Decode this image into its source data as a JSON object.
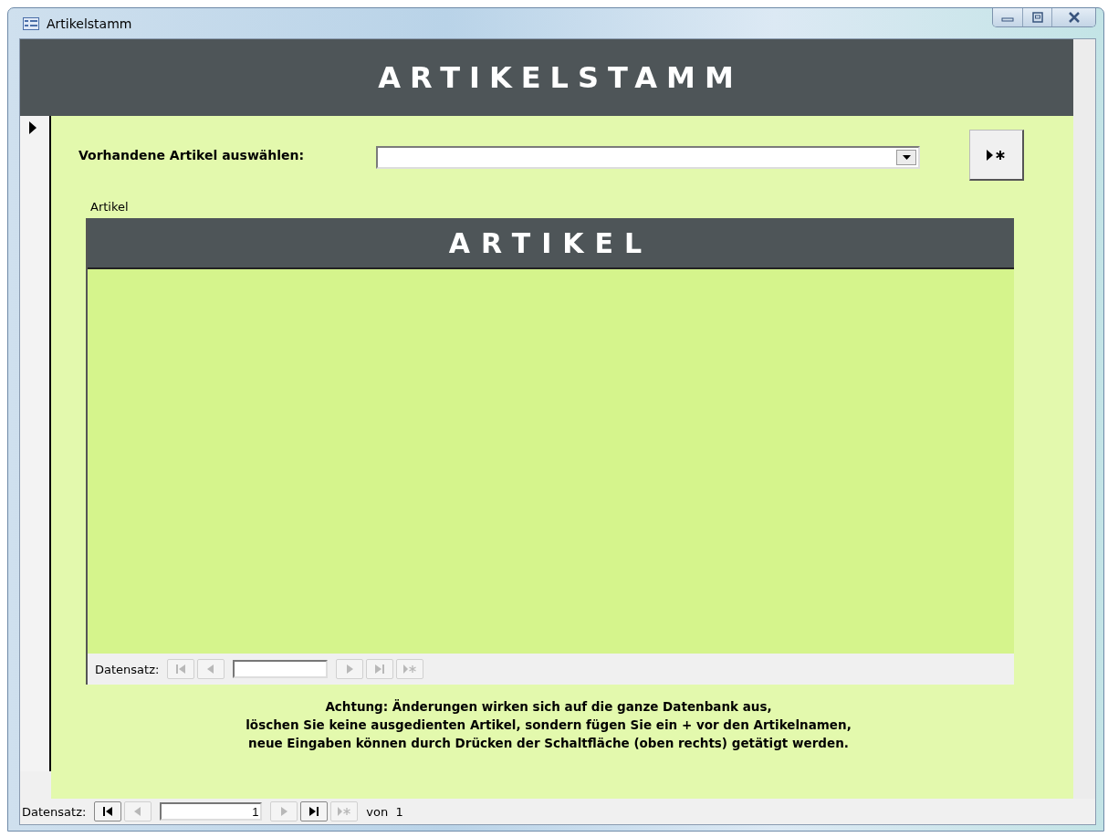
{
  "window": {
    "title": "Artikelstamm"
  },
  "form": {
    "header": "ARTIKELSTAMM",
    "record_selector_current": true,
    "combo": {
      "label": "Vorhandene Artikel auswählen:"
    },
    "subform": {
      "label": "Artikel",
      "header": "ARTIKEL",
      "navigation": {
        "label": "Datensatz:",
        "buttons": [
          {
            "kind": "first",
            "disabled": true
          },
          {
            "kind": "prev",
            "disabled": true
          },
          {
            "kind": "field"
          },
          {
            "kind": "next",
            "disabled": true
          },
          {
            "kind": "last",
            "disabled": true
          },
          {
            "kind": "new",
            "disabled": true
          }
        ]
      }
    },
    "notice": [
      "Achtung: Änderungen wirken sich auf die ganze Datenbank aus,",
      "löschen Sie keine ausgedienten Artikel, sondern fügen Sie ein + vor den Artikelnamen,",
      "neue Eingaben können durch Drücken der Schaltfläche (oben rechts) getätigt werden."
    ]
  },
  "navigation": {
    "label": "Datensatz:",
    "record": "1",
    "buttons": [
      {
        "kind": "first",
        "disabled": false
      },
      {
        "kind": "prev",
        "disabled": true
      },
      {
        "kind": "field"
      },
      {
        "kind": "next",
        "disabled": true
      },
      {
        "kind": "last",
        "disabled": false
      },
      {
        "kind": "new",
        "disabled": true
      }
    ],
    "total": "von  1"
  }
}
